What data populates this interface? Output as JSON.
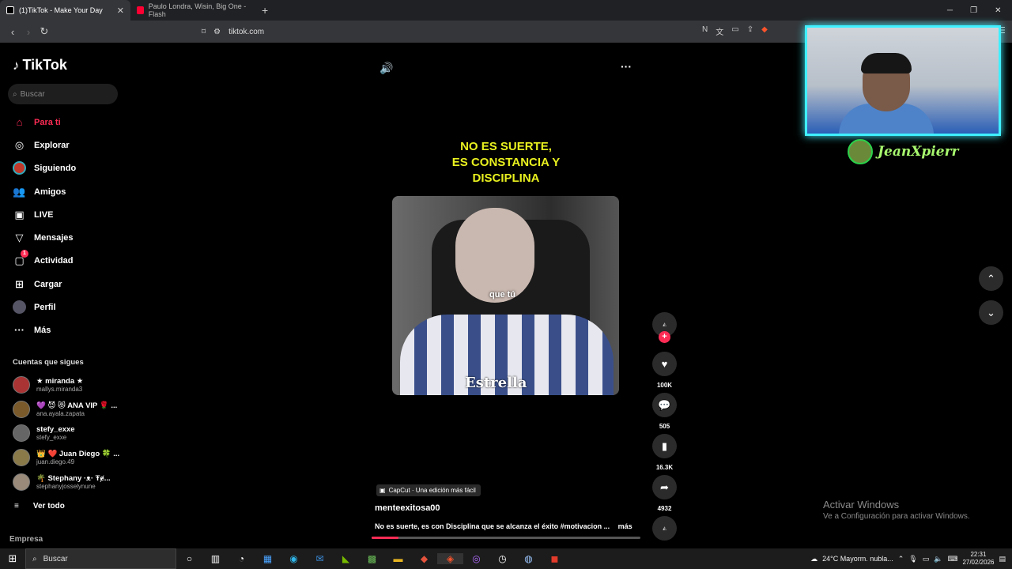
{
  "browser": {
    "tabs": [
      {
        "label": "(1)TikTok - Make Your Day",
        "active": true
      },
      {
        "label": "Paulo Londra, Wisin, Big One - Flash",
        "active": false
      }
    ],
    "url": "tiktok.com"
  },
  "sidebar": {
    "logo": "TikTok",
    "search_placeholder": "Buscar",
    "nav": [
      {
        "label": "Para ti",
        "icon": "home-icon"
      },
      {
        "label": "Explorar",
        "icon": "compass-icon"
      },
      {
        "label": "Siguiendo",
        "icon": "following-avatar-icon"
      },
      {
        "label": "Amigos",
        "icon": "friends-icon"
      },
      {
        "label": "LIVE",
        "icon": "live-tv-icon"
      },
      {
        "label": "Mensajes",
        "icon": "paper-plane-icon"
      },
      {
        "label": "Actividad",
        "icon": "activity-icon",
        "badge": "1"
      },
      {
        "label": "Cargar",
        "icon": "plus-square-icon"
      },
      {
        "label": "Perfil",
        "icon": "profile-avatar-icon"
      },
      {
        "label": "Más",
        "icon": "more-dots-icon"
      }
    ],
    "following_title": "Cuentas que sigues",
    "following": [
      {
        "name": "★ miranda ★",
        "handle": "mallys.miranda3"
      },
      {
        "name": "💜 😈 😻 ANA VIP 🌹 ...",
        "handle": "ana.ayala.zapata"
      },
      {
        "name": "stefy_exxe",
        "handle": "stefy_exxe"
      },
      {
        "name": "👑 ❤️ Juan Diego 🍀 ...",
        "handle": "juan.diego.49"
      },
      {
        "name": "🌴 Stephany ·ᴥ· Ŧɇ...",
        "handle": "stephanyjosselynune"
      }
    ],
    "see_all": "Ver todo",
    "company": "Empresa"
  },
  "video": {
    "headline": [
      "NO ES SUERTE,",
      "ES CONSTANCIA Y",
      "DISCIPLINA"
    ],
    "subtitle": "que tú",
    "sponsor": "Estrella",
    "capcut": "CapCut · Una edición más fácil",
    "author": "menteexitosa00",
    "description": "No es suerte, es con Disciplina que se alcanza el éxito #motivacion ...",
    "more_label": "más",
    "progress": 0.1
  },
  "actions": {
    "likes": "100K",
    "comments": "505",
    "saves": "16.3K",
    "shares": "4932"
  },
  "overlay": {
    "streamer_name": "JeanXpierr",
    "activate_title": "Activar Windows",
    "activate_sub": "Ve a Configuración para activar Windows."
  },
  "taskbar": {
    "search_placeholder": "Buscar",
    "weather": "24°C  Mayorm. nubla...",
    "time": "22:31",
    "date": "27/02/2026"
  },
  "colors": {
    "accent": "#fe2c55",
    "headline": "#e9f11f",
    "cam_border": "#3ff0ff"
  }
}
